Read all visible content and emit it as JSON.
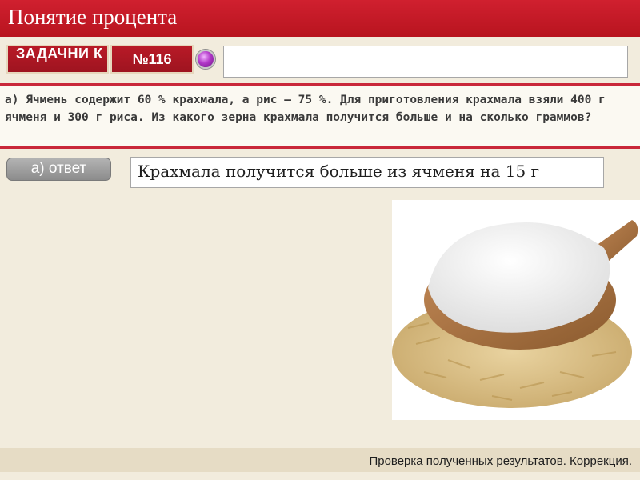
{
  "header": {
    "title": "Понятие процента"
  },
  "toolbar": {
    "zadachnik_label": "ЗАДАЧНИ К",
    "number_label": "№116",
    "answer_button_label": "а) ответ"
  },
  "problem": {
    "text": "а) Ячмень содержит 60 % крахмала, а рис — 75 %. Для приготовления крахмала взяли 400 г ячменя и 300 г риса. Из какого зерна крахмала получится больше и на сколько граммов?"
  },
  "answer": {
    "text": "Крахмала получится больше из ячменя на 15 г"
  },
  "footer": {
    "text": "Проверка полученных результатов. Коррекция."
  },
  "icons": {
    "answer_dot": "purple-dot-icon"
  },
  "colors": {
    "accent": "#c41a2a",
    "background": "#f2ecdd"
  }
}
